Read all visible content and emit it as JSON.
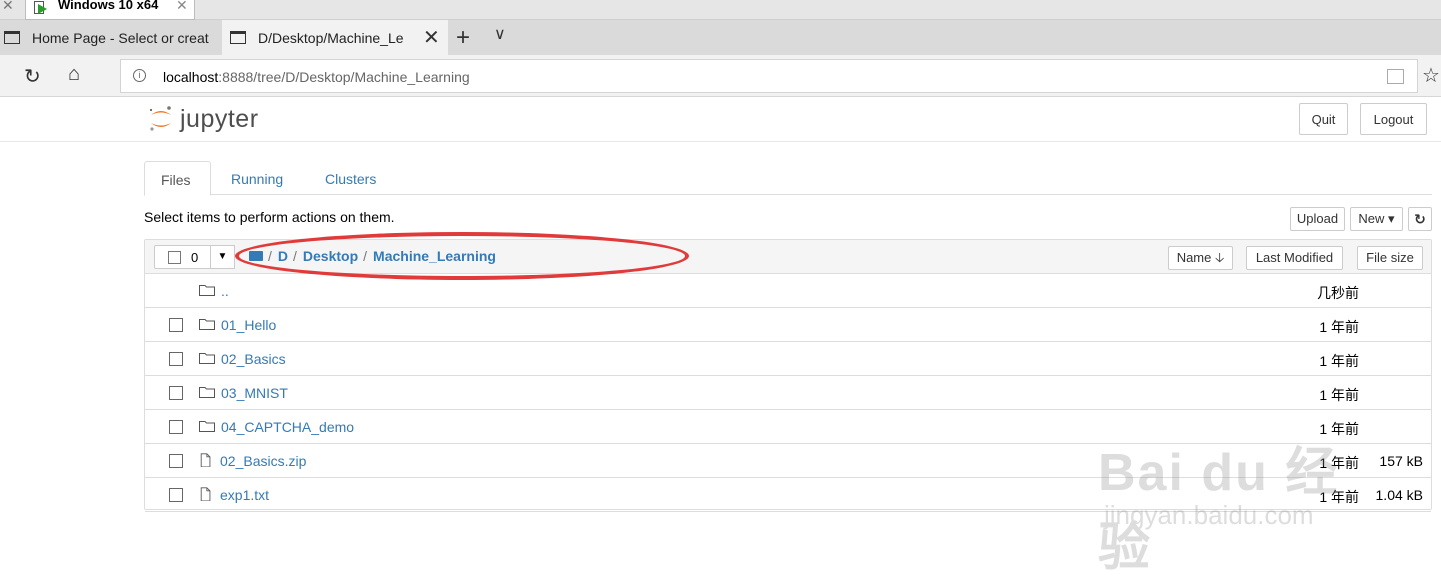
{
  "vm": {
    "tab_label": "Windows 10 x64"
  },
  "browser": {
    "tabs": [
      {
        "label": "Home Page - Select or creat"
      },
      {
        "label": "D/Desktop/Machine_Le"
      }
    ],
    "address": {
      "host": "localhost",
      "path": ":8888/tree/D/Desktop/Machine_Learning"
    }
  },
  "jupyter": {
    "logo_text": "jupyter",
    "quit_label": "Quit",
    "logout_label": "Logout",
    "tabs": [
      {
        "label": "Files"
      },
      {
        "label": "Running"
      },
      {
        "label": "Clusters"
      }
    ],
    "hint": "Select items to perform actions on them.",
    "toolbar": {
      "upload_label": "Upload",
      "new_label": "New ▾",
      "refresh_icon": "↻"
    },
    "selection_count": "0",
    "breadcrumbs": [
      {
        "label": "D"
      },
      {
        "label": "Desktop"
      },
      {
        "label": "Machine_Learning"
      }
    ],
    "columns": {
      "name": "Name 🡣",
      "last_modified": "Last Modified",
      "file_size": "File size"
    },
    "files": [
      {
        "name": "..",
        "type": "folder",
        "modified": "几秒前",
        "size": ""
      },
      {
        "name": "01_Hello",
        "type": "folder",
        "modified": "1 年前",
        "size": ""
      },
      {
        "name": "02_Basics",
        "type": "folder",
        "modified": "1 年前",
        "size": ""
      },
      {
        "name": "03_MNIST",
        "type": "folder",
        "modified": "1 年前",
        "size": ""
      },
      {
        "name": "04_CAPTCHA_demo",
        "type": "folder",
        "modified": "1 年前",
        "size": ""
      },
      {
        "name": "02_Basics.zip",
        "type": "file",
        "modified": "1 年前",
        "size": "157 kB"
      },
      {
        "name": "exp1.txt",
        "type": "file",
        "modified": "1 年前",
        "size": "1.04 kB"
      }
    ]
  },
  "watermark": {
    "brand": "Bai du 经验",
    "url": "jingyan.baidu.com"
  },
  "colors": {
    "link": "#337ab7",
    "annotation": "#e03a3a"
  }
}
